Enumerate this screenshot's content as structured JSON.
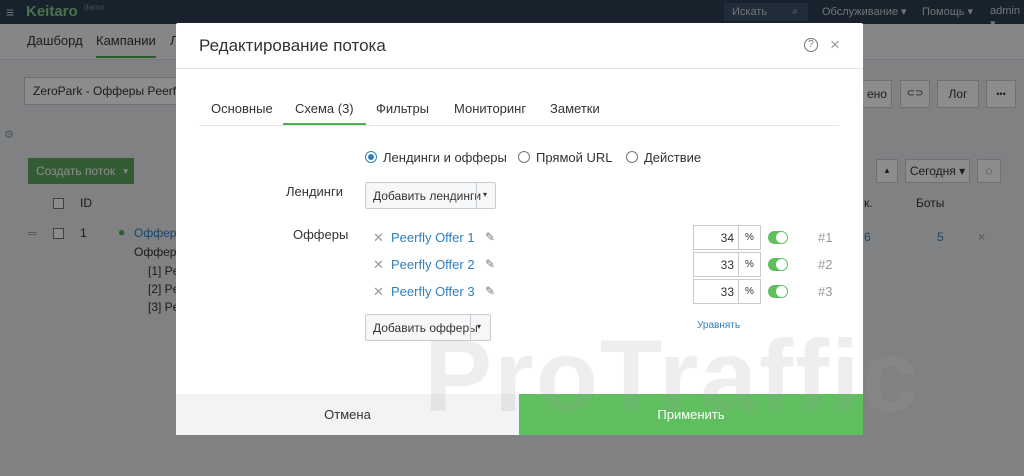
{
  "app": {
    "menu_glyph": "≡",
    "logo": "Keitaro",
    "logo_badge": "demo",
    "search_label": "Искать",
    "search_glyph": "⌕",
    "menu_service": "Обслуживание ▾",
    "menu_help": "Помощь ▾",
    "menu_user": "admin ▾"
  },
  "subnav": {
    "dashboard": "Дашборд",
    "campaigns": "Кампании",
    "third_partial": "Л"
  },
  "campaign_select": "ZeroPark - Офферы Peerfly",
  "background": {
    "create_flow": "Создать поток",
    "create_flow_caret": "▾",
    "col_id": "ID",
    "row_id": "1",
    "row_link": "Офферы",
    "row_text": "Офферы",
    "row_lines": [
      "[1] Pe",
      "[2] Pe",
      "[3] Pe"
    ],
    "right_btn_partial": "ено",
    "link_btn": "⊂⊃",
    "log_btn": "Лог",
    "more_btn": "•••",
    "up_btn": "▲",
    "today_btn": "Сегодня ▾",
    "refresh_btn": "◌",
    "col_partial": "к.",
    "col_bots": "Боты",
    "row_val_partial": "6",
    "row_bots": "5",
    "row_close": "×"
  },
  "watermark": {
    "text": "ProTraffic"
  },
  "modal": {
    "title": "Редактирование потока",
    "help_icon": "?",
    "close_icon": "×",
    "tabs": [
      "Основные",
      "Схема (3)",
      "Фильтры",
      "Мониторинг",
      "Заметки"
    ],
    "scheme_options": [
      {
        "label": "Лендинги и офферы",
        "selected": true
      },
      {
        "label": "Прямой URL",
        "selected": false
      },
      {
        "label": "Действие",
        "selected": false
      }
    ],
    "landings_label": "Лендинги",
    "add_landings": "Добавить лендинги",
    "offers_label": "Офферы",
    "offers": [
      {
        "name": "Peerfly Offer 1",
        "share": "34",
        "unit": "%",
        "enabled": true,
        "num": "#1"
      },
      {
        "name": "Peerfly Offer 2",
        "share": "33",
        "unit": "%",
        "enabled": true,
        "num": "#2"
      },
      {
        "name": "Peerfly Offer 3",
        "share": "33",
        "unit": "%",
        "enabled": true,
        "num": "#3"
      }
    ],
    "add_offers": "Добавить офферы",
    "equalize": "Уравнять",
    "cancel": "Отмена",
    "apply": "Применить",
    "remove_glyph": "✕",
    "edit_glyph": "✎",
    "caret_glyph": "▾"
  },
  "colors": {
    "accent_green": "#5fbf5f",
    "link_blue": "#2f7fc1",
    "topbar": "#2c3e50"
  }
}
